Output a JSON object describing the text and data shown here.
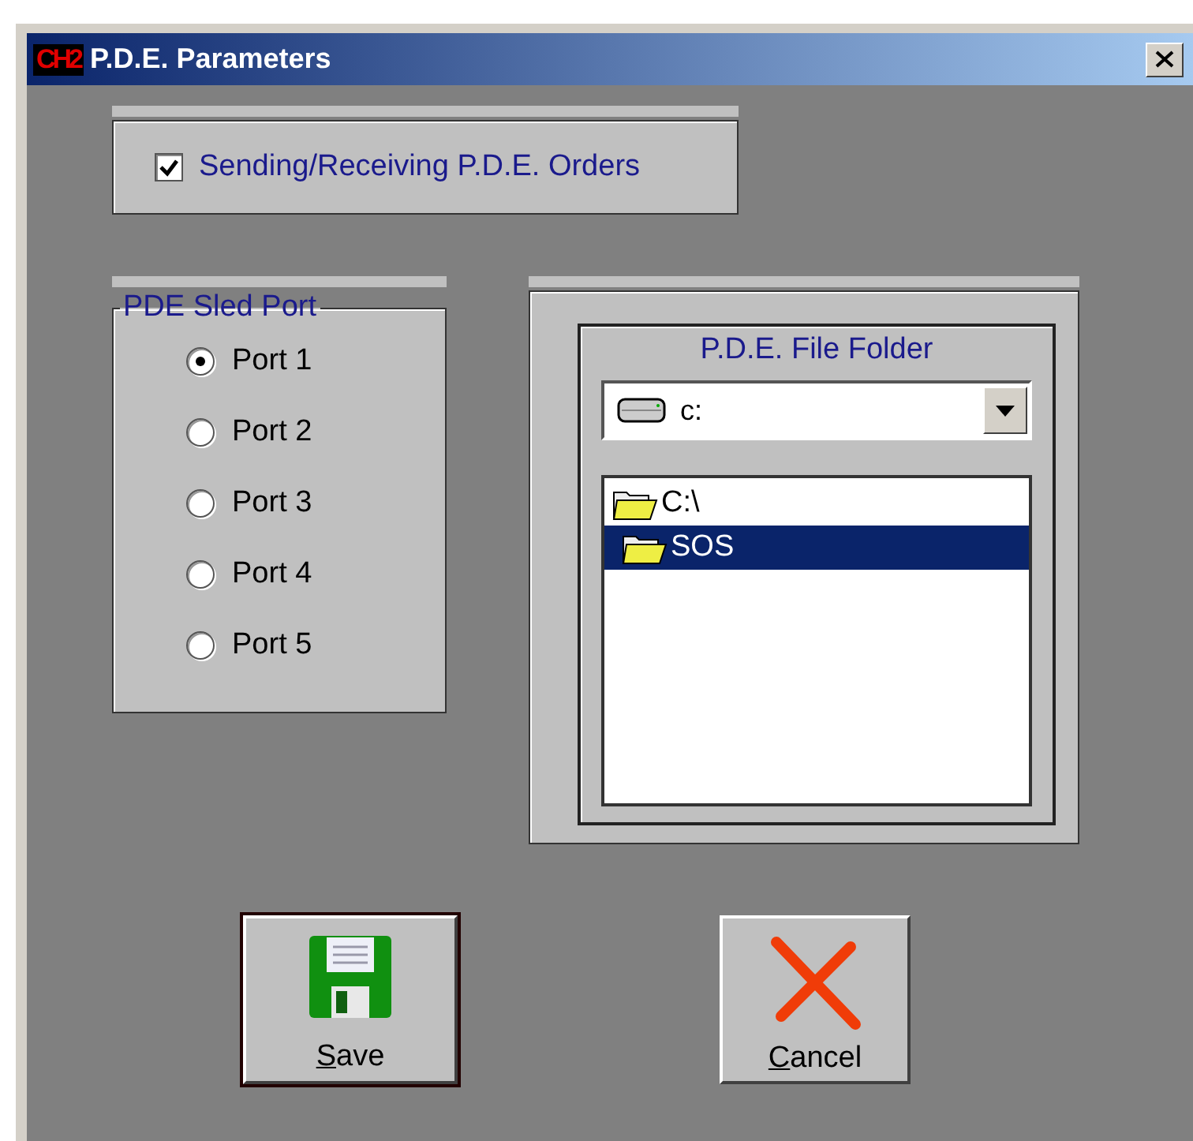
{
  "window": {
    "logo": "CH2",
    "title": "P.D.E. Parameters"
  },
  "options_panel": {
    "checkbox": {
      "label": "Sending/Receiving P.D.E. Orders",
      "checked": true
    }
  },
  "sled_port": {
    "legend": "PDE Sled Port",
    "ports": [
      {
        "label": "Port 1",
        "selected": true
      },
      {
        "label": "Port 2",
        "selected": false
      },
      {
        "label": "Port 3",
        "selected": false
      },
      {
        "label": "Port 4",
        "selected": false
      },
      {
        "label": "Port 5",
        "selected": false
      }
    ]
  },
  "file_folder": {
    "title": "P.D.E. File Folder",
    "drive": {
      "value": "c:"
    },
    "folders": [
      {
        "label": "C:\\",
        "selected": false,
        "children": [
          {
            "label": "SOS",
            "selected": true
          }
        ]
      }
    ]
  },
  "buttons": [
    {
      "kind": "save",
      "label": "Save",
      "default": true
    },
    {
      "kind": "cancel",
      "label": "Cancel",
      "default": false
    }
  ]
}
